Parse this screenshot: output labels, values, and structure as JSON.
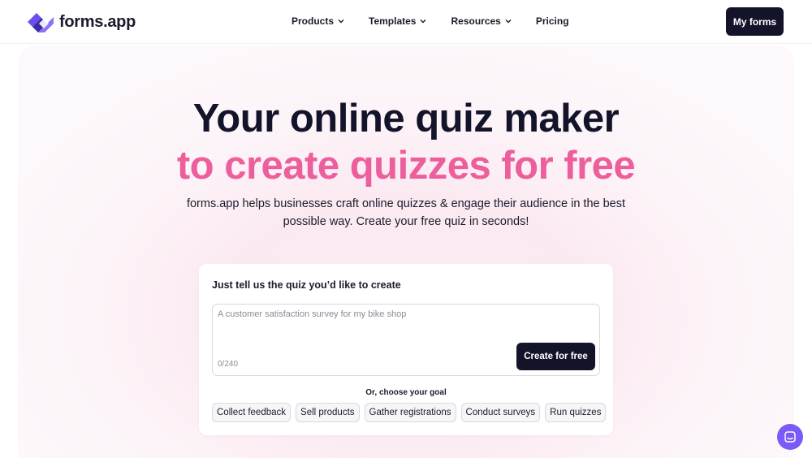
{
  "brand": {
    "name": "forms.app",
    "accent": "#ec5e9c",
    "dark": "#13132a",
    "purple": "#6c4ef0"
  },
  "nav": {
    "links": [
      {
        "label": "Products",
        "has_dropdown": true
      },
      {
        "label": "Templates",
        "has_dropdown": true
      },
      {
        "label": "Resources",
        "has_dropdown": true
      },
      {
        "label": "Pricing",
        "has_dropdown": false
      }
    ],
    "cta_label": "My forms"
  },
  "hero": {
    "title_line1": "Your online quiz maker",
    "title_line2": "to create quizzes for free",
    "subtitle": "forms.app helps businesses craft online quizzes & engage their audience in the best possible way. Create your free quiz in seconds!"
  },
  "card": {
    "prompt_label": "Just tell us the quiz you’d like to create",
    "input_placeholder": "A customer satisfaction survey for my bike shop",
    "input_value": "",
    "char_counter": "0/240",
    "create_button": "Create for free",
    "goal_label": "Or, choose your goal",
    "goals": [
      "Collect feedback",
      "Sell products",
      "Gather registrations",
      "Conduct surveys",
      "Run quizzes"
    ]
  },
  "chat": {
    "icon": "chat-icon"
  }
}
